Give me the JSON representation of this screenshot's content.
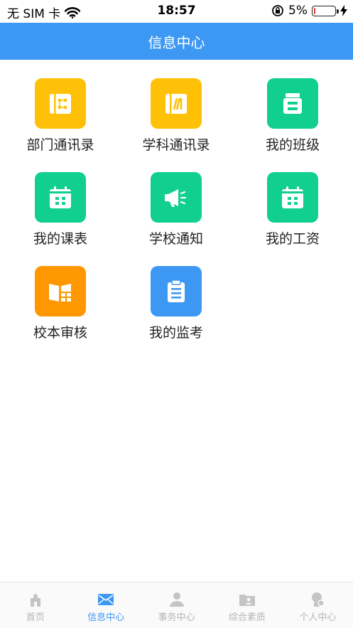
{
  "status_bar": {
    "carrier": "无 SIM 卡",
    "time": "18:57",
    "battery_text": "5%",
    "battery_level": 0.05
  },
  "header": {
    "title": "信息中心"
  },
  "tiles": [
    {
      "label": "部门通讯录",
      "icon": "contact-book-icon",
      "color": "#ffc107"
    },
    {
      "label": "学科通讯录",
      "icon": "subject-book-icon",
      "color": "#ffc107"
    },
    {
      "label": "我的班级",
      "icon": "class-icon",
      "color": "#10cf8f"
    },
    {
      "label": "我的课表",
      "icon": "calendar-icon",
      "color": "#10cf8f"
    },
    {
      "label": "学校通知",
      "icon": "megaphone-icon",
      "color": "#10cf8f"
    },
    {
      "label": "我的工资",
      "icon": "calendar-icon",
      "color": "#10cf8f"
    },
    {
      "label": "校本审核",
      "icon": "book-review-icon",
      "color": "#ff9800"
    },
    {
      "label": "我的监考",
      "icon": "clipboard-icon",
      "color": "#3d98f4"
    }
  ],
  "tabbar": {
    "active_color": "#3d98f4",
    "inactive_color": "#b5b5b5",
    "items": [
      {
        "label": "首页",
        "icon": "home-icon",
        "active": false
      },
      {
        "label": "信息中心",
        "icon": "mail-icon",
        "active": true
      },
      {
        "label": "事务中心",
        "icon": "person-desk-icon",
        "active": false
      },
      {
        "label": "综合素质",
        "icon": "profile-folder-icon",
        "active": false
      },
      {
        "label": "个人中心",
        "icon": "user-settings-icon",
        "active": false
      }
    ]
  }
}
